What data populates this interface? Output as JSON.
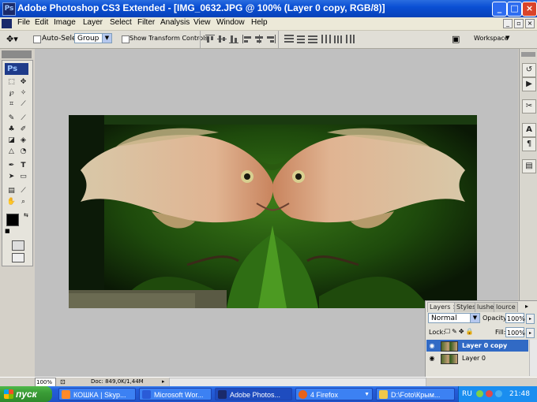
{
  "window": {
    "title": "Adobe Photoshop CS3 Extended - [IMG_0632.JPG @ 100% (Layer 0 copy, RGB/8)]",
    "ps_badge": "Ps"
  },
  "menu": [
    "File",
    "Edit",
    "Image",
    "Layer",
    "Select",
    "Filter",
    "Analysis",
    "View",
    "Window",
    "Help"
  ],
  "options_bar": {
    "auto_select_label": "Auto-Select:",
    "auto_select_value": "Group",
    "show_transform_label": "Show Transform Controls",
    "workspace_label": "Workspace"
  },
  "toolbox": {
    "badge": "Ps"
  },
  "status_bar": {
    "zoom": "100%",
    "doc": "Doc: 849,0K/1,44M"
  },
  "layers_panel": {
    "tabs": [
      "Layers ×",
      "Styles",
      "lushes",
      "lource"
    ],
    "blend_mode": "Normal",
    "opacity_label": "Opacity:",
    "opacity_value": "100%",
    "lock_label": "Lock:",
    "fill_label": "Fill:",
    "fill_value": "100%",
    "layers": [
      {
        "name": "Layer 0 copy",
        "selected": true
      },
      {
        "name": "Layer 0",
        "selected": false
      }
    ]
  },
  "taskbar": {
    "start_label": "пуск",
    "tasks": [
      {
        "label": "КОШКА | Skyp...",
        "icon_color": "#ff8a2a",
        "active": false
      },
      {
        "label": "Microsoft Wor...",
        "icon_color": "#2a5bd7",
        "active": false
      },
      {
        "label": "Adobe Photos...",
        "icon_color": "#1a2a6a",
        "active": true
      },
      {
        "label": "4 Firefox",
        "icon_color": "#e6621a",
        "active": false
      },
      {
        "label": "D:\\Foto\\Крым...",
        "icon_color": "#f0c84a",
        "active": false
      }
    ],
    "lang": "RU",
    "clock": "21:48"
  }
}
